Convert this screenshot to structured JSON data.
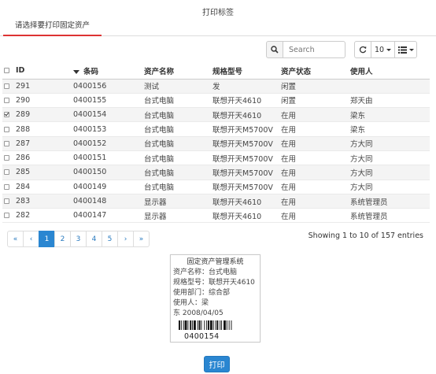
{
  "page": {
    "title": "打印标签"
  },
  "tabs": [
    {
      "label": "请选择要打印固定资产",
      "active": true
    }
  ],
  "toolbar": {
    "search_placeholder": "Search",
    "page_size": "10",
    "icons": [
      "search-icon",
      "refresh-icon",
      "columns-list-icon"
    ]
  },
  "table": {
    "columns": [
      "ID",
      "条码",
      "资产名称",
      "规格型号",
      "资产状态",
      "使用人"
    ],
    "sort_column": "条码",
    "rows": [
      {
        "checked": false,
        "id": "291",
        "code": "0400156",
        "name": "测试",
        "model": "发",
        "status": "闲置",
        "user": ""
      },
      {
        "checked": false,
        "id": "290",
        "code": "0400155",
        "name": "台式电脑",
        "model": "联想开天4610",
        "status": "闲置",
        "user": "郑天由"
      },
      {
        "checked": true,
        "id": "289",
        "code": "0400154",
        "name": "台式电脑",
        "model": "联想开天4610",
        "status": "在用",
        "user": "梁东"
      },
      {
        "checked": false,
        "id": "288",
        "code": "0400153",
        "name": "台式电脑",
        "model": "联想开天M5700V",
        "status": "在用",
        "user": "梁东"
      },
      {
        "checked": false,
        "id": "287",
        "code": "0400152",
        "name": "台式电脑",
        "model": "联想开天M5700V",
        "status": "在用",
        "user": "方大同"
      },
      {
        "checked": false,
        "id": "286",
        "code": "0400151",
        "name": "台式电脑",
        "model": "联想开天M5700V",
        "status": "在用",
        "user": "方大同"
      },
      {
        "checked": false,
        "id": "285",
        "code": "0400150",
        "name": "台式电脑",
        "model": "联想开天M5700V",
        "status": "在用",
        "user": "方大同"
      },
      {
        "checked": false,
        "id": "284",
        "code": "0400149",
        "name": "台式电脑",
        "model": "联想开天M5700V",
        "status": "在用",
        "user": "方大同"
      },
      {
        "checked": false,
        "id": "283",
        "code": "0400148",
        "name": "显示器",
        "model": "联想开天4610",
        "status": "在用",
        "user": "系统管理员"
      },
      {
        "checked": false,
        "id": "282",
        "code": "0400147",
        "name": "显示器",
        "model": "联想开天4610",
        "status": "在用",
        "user": "系统管理员"
      }
    ]
  },
  "pagination": {
    "items": [
      "«",
      "‹",
      "1",
      "2",
      "3",
      "4",
      "5",
      "›",
      "»"
    ],
    "active_page": "1",
    "summary": "Showing 1 to 10 of 157 entries"
  },
  "label": {
    "title": "固定资产管理系统",
    "lines": [
      "资产名称：台式电脑",
      "规格型号：联想开天4610",
      "使用部门：综合部",
      "使用人：梁",
      "东      2008/04/05"
    ],
    "barcode_number": "0400154"
  },
  "print_button": "打印",
  "colors": {
    "accent": "#2a86d1",
    "tab_underline": "#dd3333"
  }
}
